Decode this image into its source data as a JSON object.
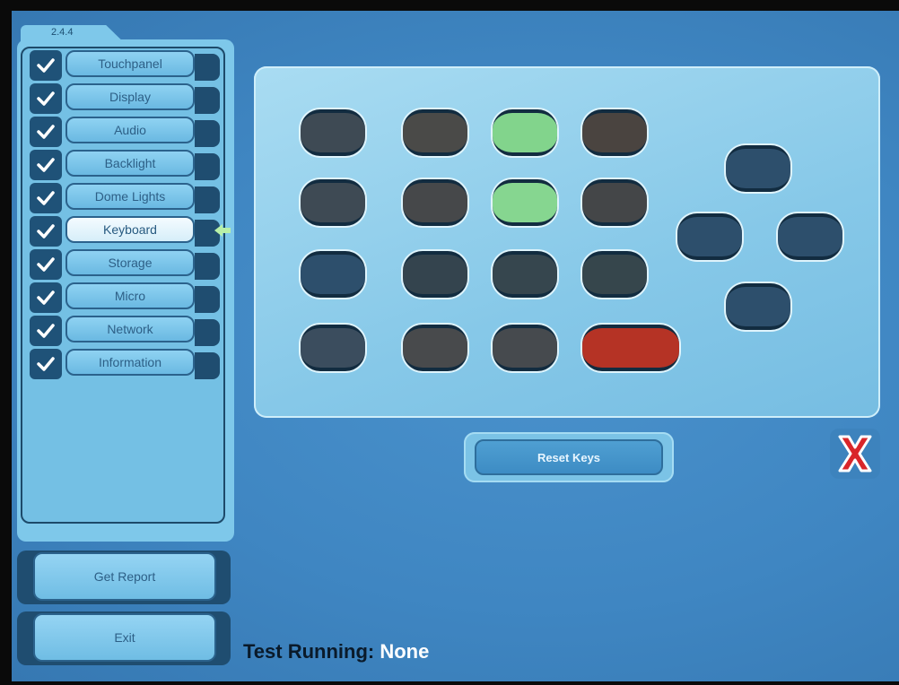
{
  "app": {
    "version": "2.4.4"
  },
  "sidebar": {
    "items": [
      {
        "label": "Touchpanel",
        "checked": true,
        "active": false
      },
      {
        "label": "Display",
        "checked": true,
        "active": false
      },
      {
        "label": "Audio",
        "checked": true,
        "active": false
      },
      {
        "label": "Backlight",
        "checked": true,
        "active": false
      },
      {
        "label": "Dome Lights",
        "checked": true,
        "active": false
      },
      {
        "label": "Keyboard",
        "checked": true,
        "active": true
      },
      {
        "label": "Storage",
        "checked": true,
        "active": false
      },
      {
        "label": "Micro",
        "checked": true,
        "active": false
      },
      {
        "label": "Network",
        "checked": true,
        "active": false
      },
      {
        "label": "Information",
        "checked": true,
        "active": false
      }
    ]
  },
  "actions": {
    "get_report_label": "Get Report",
    "exit_label": "Exit"
  },
  "keyboard_test": {
    "reset_label": "Reset Keys",
    "key_colors": {
      "idle_dark": "#3e4a54",
      "idle_blue": "#2d4f6c",
      "pressed_green": "#82d48c",
      "error_red": "#b53325"
    }
  },
  "status": {
    "label": "Test Running:",
    "value": "None"
  },
  "colors": {
    "screen_bg": "#4a92cc",
    "panel_bg": "#a9dcf2",
    "button_border": "#2b628c"
  }
}
